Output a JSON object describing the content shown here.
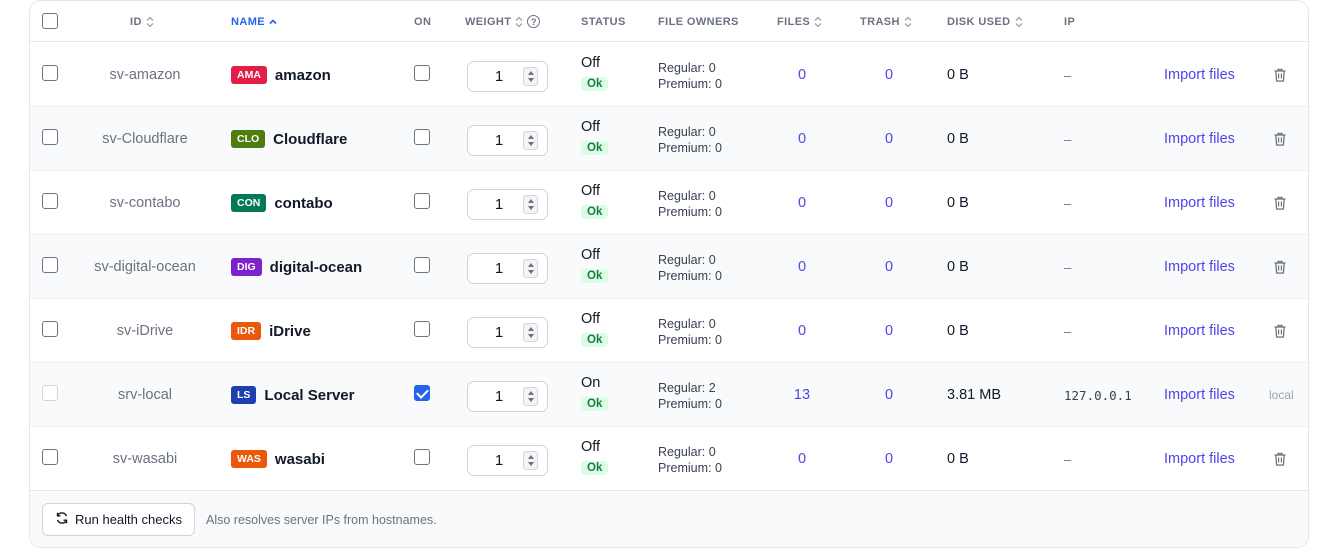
{
  "table": {
    "headers": {
      "id": "ID",
      "name": "NAME",
      "on": "ON",
      "weight": "WEIGHT",
      "status": "STATUS",
      "file_owners": "FILE OWNERS",
      "files": "FILES",
      "trash": "TRASH",
      "disk_used": "DISK USED",
      "ip": "IP"
    },
    "sort_active": "name",
    "rows": [
      {
        "id": "sv-amazon",
        "badge": "AMA",
        "badge_color": "#e11d48",
        "name": "amazon",
        "on": false,
        "weight": "1",
        "status": "Off",
        "health": "Ok",
        "regular": "Regular: 0",
        "premium": "Premium: 0",
        "files": "0",
        "trash": "0",
        "disk": "0 B",
        "ip": "–",
        "action": "Import files",
        "deletable": true
      },
      {
        "id": "sv-Cloudflare",
        "badge": "CLO",
        "badge_color": "#4d7c0f",
        "name": "Cloudflare",
        "on": false,
        "weight": "1",
        "status": "Off",
        "health": "Ok",
        "regular": "Regular: 0",
        "premium": "Premium: 0",
        "files": "0",
        "trash": "0",
        "disk": "0 B",
        "ip": "–",
        "action": "Import files",
        "deletable": true
      },
      {
        "id": "sv-contabo",
        "badge": "CON",
        "badge_color": "#047857",
        "name": "contabo",
        "on": false,
        "weight": "1",
        "status": "Off",
        "health": "Ok",
        "regular": "Regular: 0",
        "premium": "Premium: 0",
        "files": "0",
        "trash": "0",
        "disk": "0 B",
        "ip": "–",
        "action": "Import files",
        "deletable": true
      },
      {
        "id": "sv-digital-ocean",
        "badge": "DIG",
        "badge_color": "#7e22ce",
        "name": "digital-ocean",
        "on": false,
        "weight": "1",
        "status": "Off",
        "health": "Ok",
        "regular": "Regular: 0",
        "premium": "Premium: 0",
        "files": "0",
        "trash": "0",
        "disk": "0 B",
        "ip": "–",
        "action": "Import files",
        "deletable": true
      },
      {
        "id": "sv-iDrive",
        "badge": "IDR",
        "badge_color": "#ea580c",
        "name": "iDrive",
        "on": false,
        "weight": "1",
        "status": "Off",
        "health": "Ok",
        "regular": "Regular: 0",
        "premium": "Premium: 0",
        "files": "0",
        "trash": "0",
        "disk": "0 B",
        "ip": "–",
        "action": "Import files",
        "deletable": true
      },
      {
        "id": "srv-local",
        "badge": "LS",
        "badge_color": "#1e40af",
        "name": "Local Server",
        "on": true,
        "weight": "1",
        "status": "On",
        "health": "Ok",
        "regular": "Regular: 2",
        "premium": "Premium: 0",
        "files": "13",
        "trash": "0",
        "disk": "3.81 MB",
        "ip": "127.0.0.1",
        "action": "Import files",
        "deletable": false,
        "tag": "local"
      },
      {
        "id": "sv-wasabi",
        "badge": "WAS",
        "badge_color": "#ea580c",
        "name": "wasabi",
        "on": false,
        "weight": "1",
        "status": "Off",
        "health": "Ok",
        "regular": "Regular: 0",
        "premium": "Premium: 0",
        "files": "0",
        "trash": "0",
        "disk": "0 B",
        "ip": "–",
        "action": "Import files",
        "deletable": true
      }
    ]
  },
  "footer": {
    "run_label": "Run health checks",
    "note": "Also resolves server IPs from hostnames."
  },
  "colors": {
    "accent": "#2563eb",
    "link": "#4f46e5",
    "ok_bg": "#dcfce7",
    "ok_text": "#15803d"
  },
  "icons": {
    "sort": "sort-arrows-icon",
    "sort_active": "sort-up-icon",
    "help": "help-circle-icon",
    "delete": "trash-icon",
    "refresh": "refresh-icon"
  }
}
